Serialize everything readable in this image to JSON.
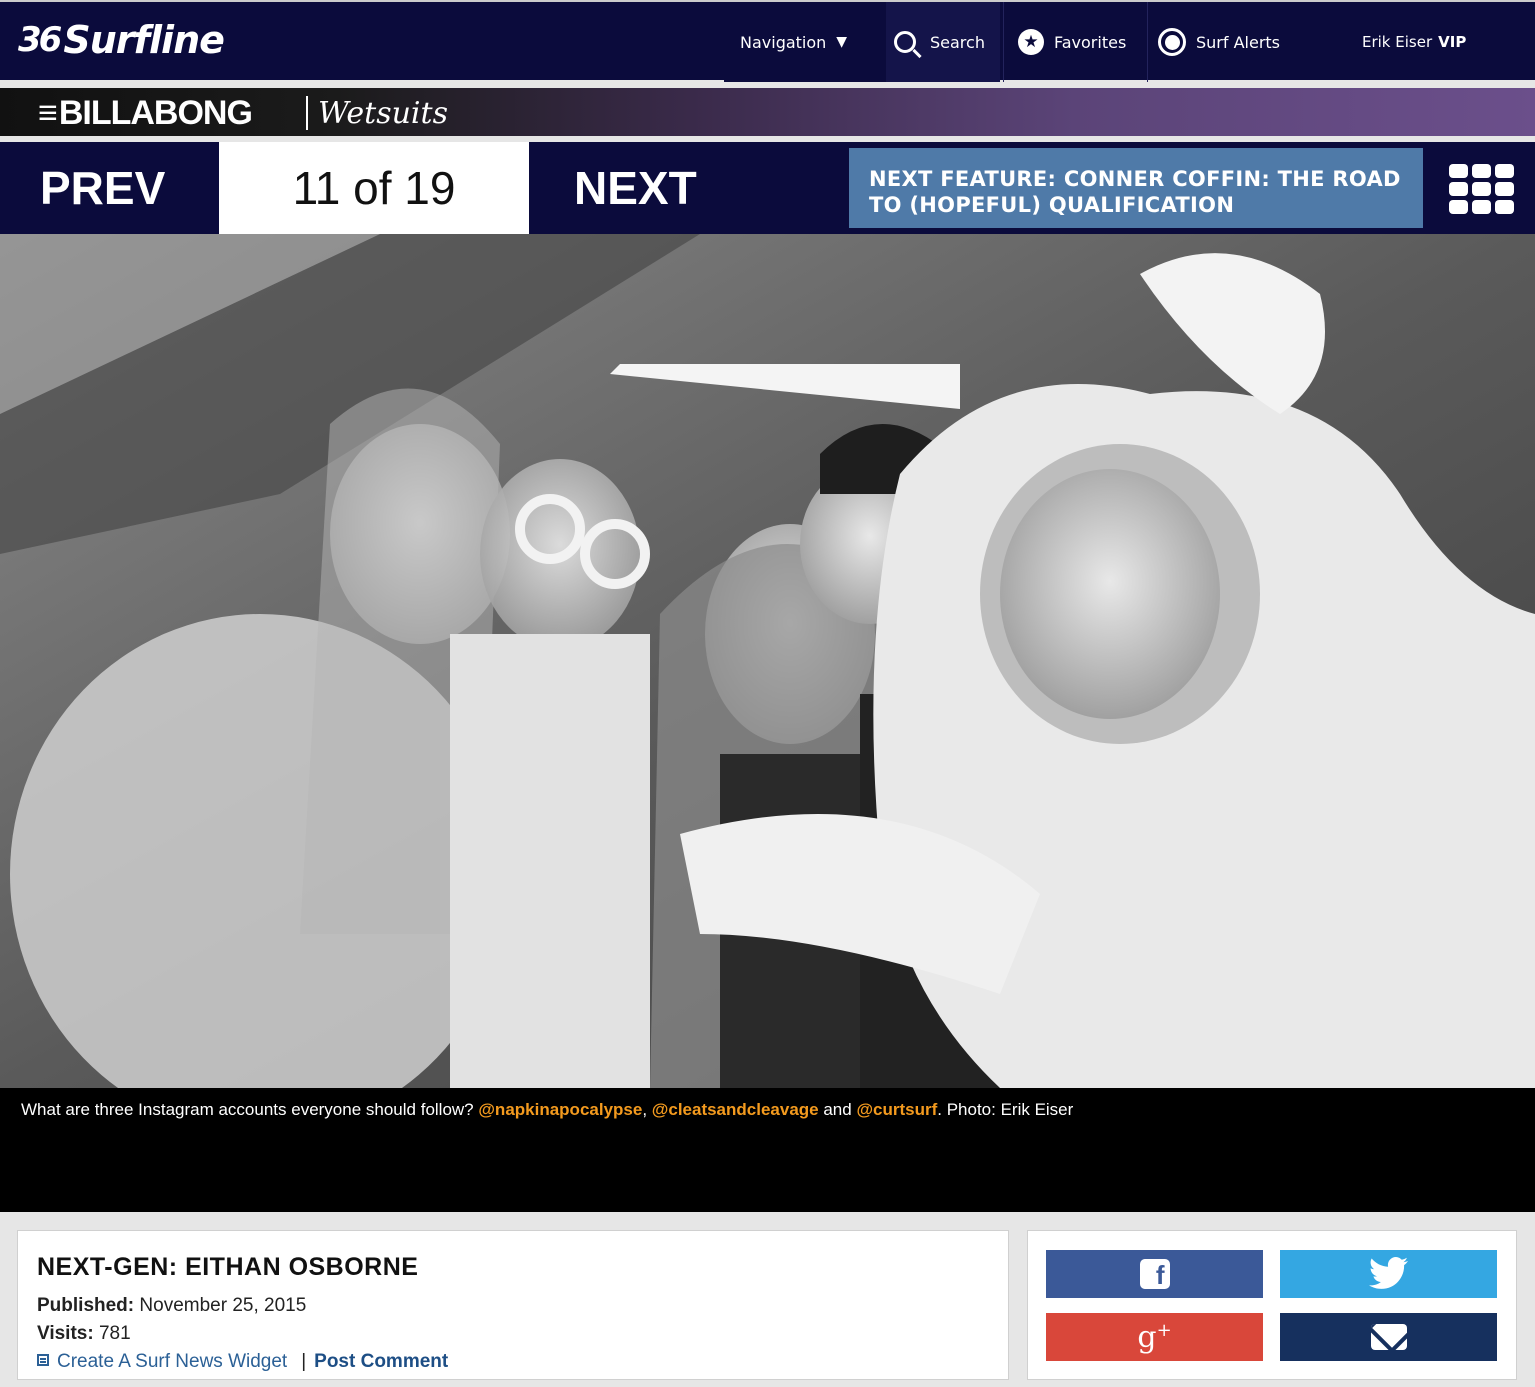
{
  "header": {
    "logo_mark": "36",
    "logo_word": "Surfline",
    "nav_label": "Navigation",
    "nav_caret": "▼",
    "search_label": "Search",
    "favorites_label": "Favorites",
    "alerts_label": "Surf Alerts",
    "user_name": "Erik Eiser",
    "user_badge": "VIP"
  },
  "ad": {
    "brand": "BILLABONG",
    "product": "Wetsuits"
  },
  "pager": {
    "prev_label": "PREV",
    "counter": "11 of 19",
    "next_label": "NEXT",
    "next_feature": "NEXT FEATURE: CONNER COFFIN: THE ROAD TO (HOPEFUL) QUALIFICATION"
  },
  "caption": {
    "prefix": "What are three Instagram accounts everyone should follow? ",
    "account1": "@napkinapocalypse",
    "sep1": ", ",
    "account2": "@cleatsandcleavage",
    "sep2": " and ",
    "account3": "@curtsurf",
    "suffix": ". Photo: Erik Eiser"
  },
  "article": {
    "title": "NEXT-GEN: EITHAN OSBORNE",
    "published_label": "Published:",
    "published_value": "November 25, 2015",
    "visits_label": "Visits:",
    "visits_value": "781",
    "widget_link": "Create A Surf News Widget",
    "pipe": "|",
    "comment_link": "Post Comment"
  },
  "share": {
    "facebook_icon": "facebook-icon",
    "twitter_icon": "twitter-icon",
    "googleplus_icon": "google-plus-icon",
    "email_icon": "email-icon",
    "gplus_glyph": "g",
    "gplus_sup": "+",
    "fb_glyph": "f"
  },
  "colors": {
    "nav_bg": "#0b0b3c",
    "feature_bg": "#4f7aa8",
    "caption_link": "#f39a1e",
    "facebook": "#3b5998",
    "twitter": "#34a7e2",
    "googleplus": "#d9473a",
    "email": "#16305e"
  }
}
